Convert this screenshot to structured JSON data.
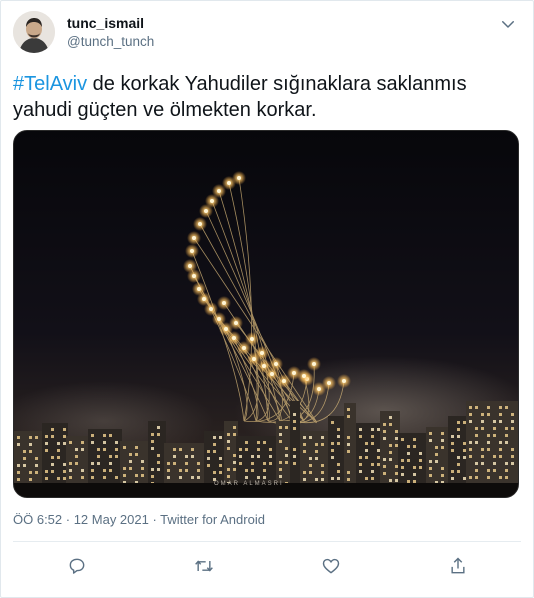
{
  "author": {
    "display_name": "tunc_ismail",
    "handle": "@tunch_tunch"
  },
  "tweet": {
    "hashtag": "#TelAviv",
    "text": " de korkak Yahudiler sığınaklara saklanmıs yahudi güçten ve ölmekten korkar."
  },
  "media": {
    "caption": "OMAR ALMASRI"
  },
  "meta": {
    "text": "ÖÖ 6:52 · 12 May 2021 · Twitter for Android"
  },
  "actions": [
    "reply-icon",
    "retweet-icon",
    "like-icon",
    "share-icon"
  ],
  "colors": {
    "accent": "#1b95e0",
    "muted": "#5b7083"
  }
}
